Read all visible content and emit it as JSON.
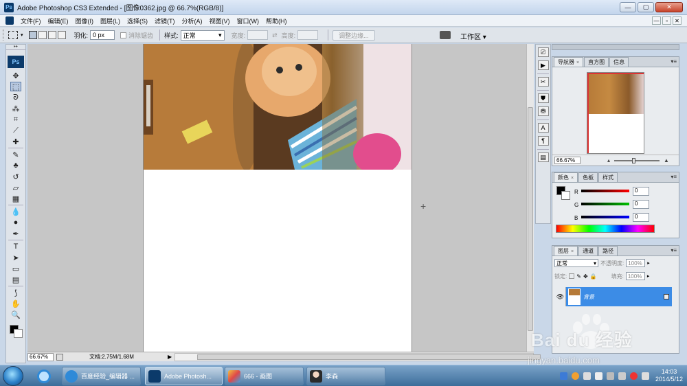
{
  "window": {
    "title": "Adobe Photoshop CS3 Extended - [图像0362.jpg @ 66.7%(RGB/8)]",
    "app_icon_label": "Ps",
    "min": "—",
    "max": "▢",
    "close": "✕"
  },
  "menu": {
    "items": [
      "文件(F)",
      "编辑(E)",
      "图像(I)",
      "图层(L)",
      "选择(S)",
      "滤镜(T)",
      "分析(A)",
      "视图(V)",
      "窗口(W)",
      "帮助(H)"
    ],
    "doc_min": "—",
    "doc_restore": "▫",
    "doc_close": "✕"
  },
  "options": {
    "feather_label": "羽化:",
    "feather_value": "0 px",
    "antialias_label": "消除锯齿",
    "style_label": "样式:",
    "style_value": "正常",
    "width_label": "宽度:",
    "height_label": "高度:",
    "swap": "⇄",
    "refine_edge": "调整边缘...",
    "workspace": "工作区 ▾"
  },
  "toolbox": {
    "logo": "Ps",
    "grip": "▸▸",
    "tools": [
      {
        "name": "move-tool",
        "glyph": "✥"
      },
      {
        "name": "marquee-tool",
        "glyph": "⬚",
        "active": true
      },
      {
        "name": "lasso-tool",
        "glyph": "ᘐ"
      },
      {
        "name": "quick-selection-tool",
        "glyph": "⁂"
      },
      {
        "name": "crop-tool",
        "glyph": "⌗"
      },
      {
        "name": "slice-tool",
        "glyph": "⟋"
      },
      {
        "name": "healing-brush-tool",
        "glyph": "✚"
      },
      {
        "name": "brush-tool",
        "glyph": "✎"
      },
      {
        "name": "clone-stamp-tool",
        "glyph": "♣"
      },
      {
        "name": "history-brush-tool",
        "glyph": "↺"
      },
      {
        "name": "eraser-tool",
        "glyph": "▱"
      },
      {
        "name": "gradient-tool",
        "glyph": "▦"
      },
      {
        "name": "blur-tool",
        "glyph": "💧"
      },
      {
        "name": "dodge-tool",
        "glyph": "●"
      },
      {
        "name": "pen-tool",
        "glyph": "✒"
      },
      {
        "name": "type-tool",
        "glyph": "T"
      },
      {
        "name": "path-selection-tool",
        "glyph": "➤"
      },
      {
        "name": "shape-tool",
        "glyph": "▭"
      },
      {
        "name": "notes-tool",
        "glyph": "▤"
      },
      {
        "name": "eyedropper-tool",
        "glyph": "⟆"
      },
      {
        "name": "hand-tool",
        "glyph": "✋"
      },
      {
        "name": "zoom-tool",
        "glyph": "🔍"
      }
    ]
  },
  "status": {
    "zoom": "66.67%",
    "doc_info": "文档:2.75M/1.68M",
    "arrow": "▶"
  },
  "dock": {
    "icons": [
      "⎚",
      "▶",
      "✂",
      "⛊",
      "⛃",
      "A",
      "¶",
      "▤"
    ]
  },
  "navigator": {
    "tabs": [
      {
        "label": "导航器",
        "active": true,
        "close": "×"
      },
      {
        "label": "直方图",
        "active": false
      },
      {
        "label": "信息",
        "active": false
      }
    ],
    "zoom": "66.67%",
    "menu": "▾≡"
  },
  "color": {
    "tabs": [
      {
        "label": "颜色",
        "active": true,
        "close": "×"
      },
      {
        "label": "色板",
        "active": false
      },
      {
        "label": "样式",
        "active": false
      }
    ],
    "channels": [
      {
        "label": "R",
        "value": "0",
        "gradient": "linear-gradient(90deg,#000,#ff0000)"
      },
      {
        "label": "G",
        "value": "0",
        "gradient": "linear-gradient(90deg,#000,#00c000)"
      },
      {
        "label": "B",
        "value": "0",
        "gradient": "linear-gradient(90deg,#000,#0000ff)"
      }
    ]
  },
  "layers": {
    "tabs": [
      {
        "label": "图层",
        "active": true,
        "close": "×"
      },
      {
        "label": "通道",
        "active": false
      },
      {
        "label": "路径",
        "active": false
      }
    ],
    "blend_mode": "正常",
    "opacity_label": "不透明度:",
    "opacity_value": "100%",
    "lock_label": "锁定:",
    "fill_label": "填充:",
    "fill_value": "100%",
    "layer_name": "背景",
    "eye": "👁"
  },
  "watermark": {
    "main": "Bai du 经验",
    "sub": "jingyan.baidu.com"
  },
  "taskbar": {
    "items": [
      {
        "label": "百度经验_编辑器 ...",
        "color": "#2f8ad8",
        "active": false
      },
      {
        "label": "Adobe Photosh...",
        "color": "#0b3a6a",
        "active": true
      },
      {
        "label": "666 - 画图",
        "color": "#f0c040",
        "active": false
      },
      {
        "label": "李森",
        "color": "#2a2a2a",
        "active": false
      }
    ],
    "time": "14:03",
    "date": "2014/5/12",
    "colors": {
      "accent": "#3c8ce6",
      "ps_brand": "#0b3a6a"
    }
  }
}
